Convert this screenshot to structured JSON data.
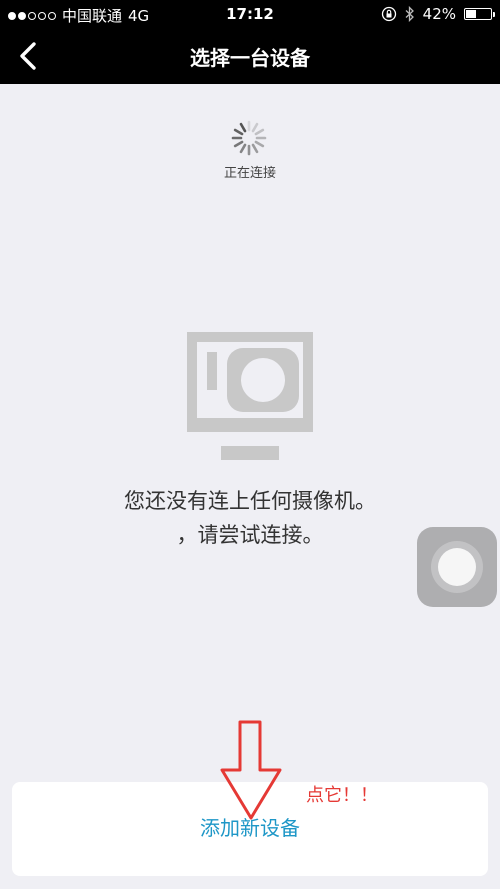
{
  "status_bar": {
    "carrier": "中国联通",
    "network": "4G",
    "time": "17:12",
    "battery": "42%",
    "battery_level": 0.42
  },
  "nav": {
    "title": "选择一台设备"
  },
  "main": {
    "connecting": "正在连接",
    "empty_line1": "您还没有连上任何摄像机。",
    "empty_line2": "，请尝试连接。"
  },
  "add_device": {
    "label": "添加新设备"
  },
  "annotation": {
    "text": "点它！！"
  },
  "colors": {
    "accent": "#1e97c7",
    "annotation": "#e53935"
  }
}
